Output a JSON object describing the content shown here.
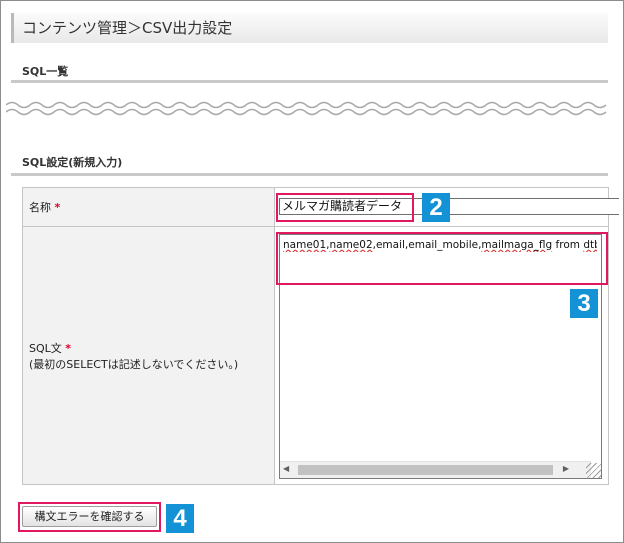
{
  "page": {
    "title": "コンテンツ管理＞CSV出力設定"
  },
  "sections": {
    "sql_list": "SQL一覧",
    "sql_settings": "SQL設定(新規入力)"
  },
  "form": {
    "name_label": "名称",
    "required_mark": "*",
    "name_value": "メルマガ購読者データ",
    "sql_label": "SQL文",
    "sql_note": "(最初のSELECTは記述しないでください。)",
    "sql_value_parts": [
      "name01",
      ",",
      "name02",
      ",email,email_mobile,",
      "mailmaga_flg",
      " from ",
      "dtb"
    ]
  },
  "buttons": {
    "check_syntax": "構文エラーを確認する"
  },
  "callouts": {
    "name": "2",
    "sql": "3",
    "button": "4"
  },
  "colors": {
    "callout_badge": "#1393d6",
    "highlight_border": "#e0185f",
    "required": "#e0002a"
  },
  "icons": [
    "arrow-left-icon",
    "arrow-right-icon",
    "resize-grip-icon"
  ]
}
